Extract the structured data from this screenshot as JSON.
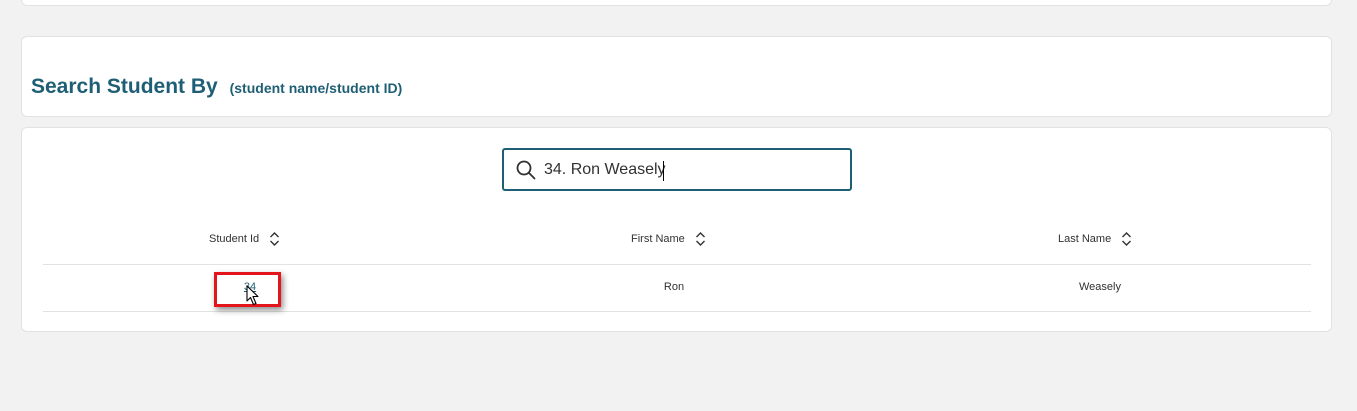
{
  "header": {
    "title": "Search Student By",
    "subtitle": "(student name/student ID)"
  },
  "search": {
    "value": "34. Ron Weasely",
    "placeholder": ""
  },
  "table": {
    "columns": [
      {
        "label": "Student Id",
        "icon": "sort-icon"
      },
      {
        "label": "First Name",
        "icon": "sort-icon"
      },
      {
        "label": "Last Name",
        "icon": "sort-icon"
      }
    ],
    "rows": [
      {
        "student_id": "34",
        "first_name": "Ron",
        "last_name": "Weasely"
      }
    ]
  },
  "colors": {
    "accent": "#1f5f75",
    "highlight": "#e3151a",
    "background": "#f1f2f1"
  }
}
